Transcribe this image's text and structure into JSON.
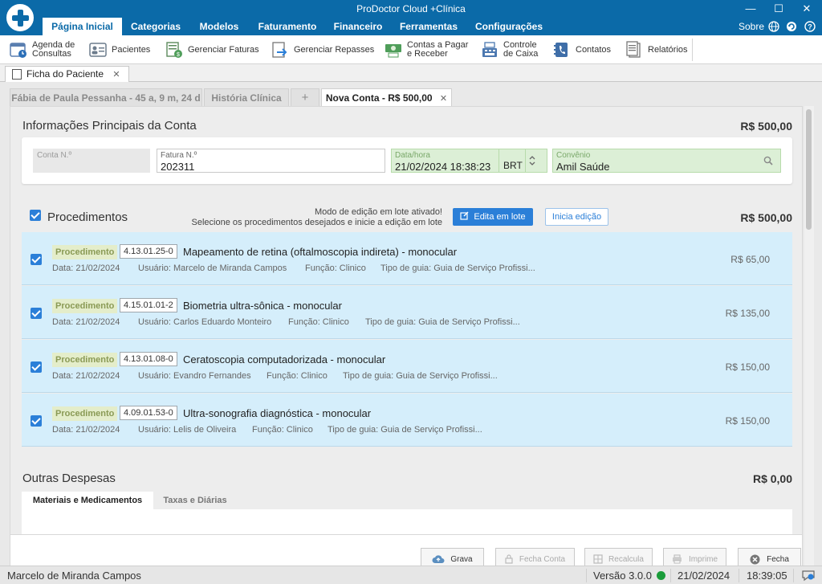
{
  "app": {
    "title": "ProDoctor Cloud +Clínica",
    "window_controls": [
      "—",
      "☐",
      "✕"
    ]
  },
  "ribbon_tabs": [
    {
      "label": "Página Inicial",
      "active": true
    },
    {
      "label": "Categorias"
    },
    {
      "label": "Modelos"
    },
    {
      "label": "Faturamento"
    },
    {
      "label": "Financeiro"
    },
    {
      "label": "Ferramentas"
    },
    {
      "label": "Configurações"
    }
  ],
  "right_tools": {
    "sobre": "Sobre",
    "globe_icon": "globe-icon",
    "refresh_icon": "refresh-icon",
    "help_icon": "help-icon"
  },
  "ribbon_buttons": [
    {
      "label": "Agenda de\nConsultas",
      "icon": "calendar-icon",
      "color": "#5a7fb0"
    },
    {
      "label": "Pacientes",
      "icon": "patients-icon",
      "color": "#6c7c8c"
    },
    {
      "label": "Gerenciar Faturas",
      "icon": "invoices-icon",
      "color": "#5c8a5c"
    },
    {
      "label": "Gerenciar Repasses",
      "icon": "transfer-icon",
      "color": "#4a87c5"
    },
    {
      "label": "Contas a Pagar\ne Receber",
      "icon": "money-icon",
      "color": "#4f9e5a"
    },
    {
      "label": "Controle\nde Caixa",
      "icon": "cash-register-icon",
      "color": "#4c78b0"
    },
    {
      "label": "Contatos",
      "icon": "contacts-icon",
      "color": "#3f6ea8"
    },
    {
      "label": "Relatórios",
      "icon": "reports-icon",
      "color": "#777777"
    }
  ],
  "doc_tab": {
    "label": "Ficha do Paciente",
    "close": "✕"
  },
  "sub_tabs": [
    {
      "label": "Fábia de Paula Pessanha - 45 a, 9 m, 24 d",
      "active": false
    },
    {
      "label": "História Clínica",
      "active": false
    },
    {
      "label": "+",
      "active": false
    },
    {
      "label": "Nova Conta - R$ 500,00",
      "close": "✕",
      "active": true
    }
  ],
  "account_info": {
    "title": "Informações Principais da Conta",
    "total": "R$ 500,00",
    "fields": {
      "conta": {
        "label": "Conta N.º",
        "value": ""
      },
      "fatura": {
        "label": "Fatura N.º",
        "value": "202311"
      },
      "datahora": {
        "label": "Data/hora",
        "value": "21/02/2024 18:38:23",
        "tz": "BRT"
      },
      "convenio": {
        "label": "Convênio",
        "value": "Amil Saúde"
      }
    }
  },
  "procedures": {
    "title": "Procedimentos",
    "total": "R$ 500,00",
    "note_line1": "Modo de edição em lote ativado!",
    "note_line2": "Selecione os procedimentos desejados e inicie a edição em lote",
    "batch_button": "Edita em lote",
    "start_button": "Inicia edição",
    "items": [
      {
        "type": "Procedimento",
        "code": "4.13.01.25-0",
        "name": "Mapeamento de retina (oftalmoscopia indireta) - monocular",
        "date": "Data: 21/02/2024",
        "user": "Usuário: Marcelo de Miranda Campos",
        "role": "Função: Clinico",
        "guide": "Tipo de guia: Guia de Serviço Profissi...",
        "price": "R$ 65,00"
      },
      {
        "type": "Procedimento",
        "code": "4.15.01.01-2",
        "name": "Biometria ultra-sônica - monocular",
        "date": "Data: 21/02/2024",
        "user": "Usuário: Carlos Eduardo Monteiro",
        "role": "Função: Clinico",
        "guide": "Tipo de guia: Guia de Serviço Profissi...",
        "price": "R$ 135,00"
      },
      {
        "type": "Procedimento",
        "code": "4.13.01.08-0",
        "name": "Ceratoscopia computadorizada - monocular",
        "date": "Data: 21/02/2024",
        "user": "Usuário: Evandro Fernandes",
        "role": "Função: Clinico",
        "guide": "Tipo de guia: Guia de Serviço Profissi...",
        "price": "R$ 150,00"
      },
      {
        "type": "Procedimento",
        "code": "4.09.01.53-0",
        "name": "Ultra-sonografia diagnóstica - monocular",
        "date": "Data: 21/02/2024",
        "user": "Usuário: Lelis de Oliveira",
        "role": "Função: Clinico",
        "guide": "Tipo de guia: Guia de Serviço Profissi...",
        "price": "R$ 150,00"
      }
    ]
  },
  "other_expenses": {
    "title": "Outras Despesas",
    "total": "R$ 0,00",
    "tabs": [
      {
        "label": "Materiais e Medicamentos",
        "active": true
      },
      {
        "label": "Taxas e Diárias",
        "active": false
      }
    ]
  },
  "footer_buttons": [
    {
      "label": "Grava",
      "icon": "upload-cloud-icon",
      "enabled": true
    },
    {
      "label": "Fecha Conta",
      "icon": "lock-icon",
      "enabled": false
    },
    {
      "label": "Recalcula",
      "icon": "calculator-icon",
      "enabled": false
    },
    {
      "label": "Imprime",
      "icon": "printer-icon",
      "enabled": false
    },
    {
      "label": "Fecha",
      "icon": "close-circle-icon",
      "enabled": true
    }
  ],
  "status": {
    "user": "Marcelo de Miranda Campos",
    "version": "Versão 3.0.0",
    "online_color": "#1a9c3a",
    "date": "21/02/2024",
    "time": "18:39:05"
  }
}
